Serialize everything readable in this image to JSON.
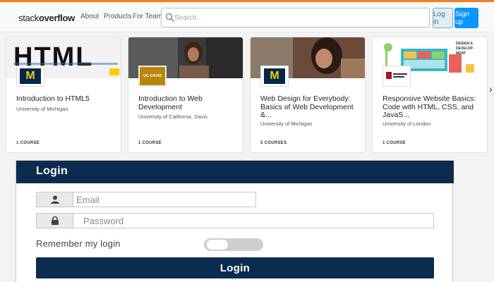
{
  "header": {
    "logo_text_light": "stack",
    "logo_text_bold": "overflow",
    "nav": [
      "About",
      "Products",
      "For Teams"
    ],
    "search_placeholder": "Search...",
    "login_label": "Log in",
    "signup_label": "Sign up",
    "accent_color": "#f48024"
  },
  "courses": [
    {
      "banner_text": "HTML",
      "logo": "michigan-logo",
      "title": "Introduction to HTML5",
      "university": "University of Michigan",
      "count": "1 COURSE"
    },
    {
      "banner_text": "",
      "logo": "uc-davis-logo",
      "logo_text": "UC DAVIS",
      "title": "Introduction to Web Development",
      "university": "University of California, Davis",
      "count": "1 COURSE"
    },
    {
      "banner_text": "",
      "logo": "michigan-logo",
      "title": "Web Design for Everybody: Basics of Web Development &...",
      "university": "University of Michigan",
      "count": "5 COURSES"
    },
    {
      "banner_text": "DESIGN & DEVELOPMENT",
      "logo": "university-of-london-logo",
      "title": "Responsive Website Basics: Code with HTML, CSS, and JavaS...",
      "university": "University of London",
      "count": "1 COURSE"
    }
  ],
  "login": {
    "title": "Login",
    "email_placeholder": "Email",
    "password_placeholder": "Password",
    "remember_label": "Remember my login",
    "remember_checked": false,
    "button_label": "Login",
    "primary_color": "#0b2c4f"
  }
}
